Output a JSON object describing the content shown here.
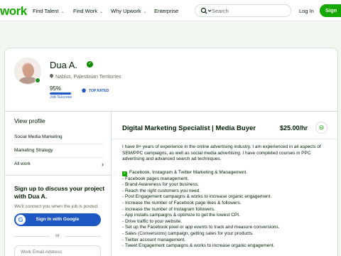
{
  "nav": {
    "logo": "work",
    "items": [
      {
        "label": "Find Talent"
      },
      {
        "label": "Find Work"
      },
      {
        "label": "Why Upwork"
      },
      {
        "label": "Enterprise"
      }
    ],
    "search_placeholder": "Search",
    "login_label": "Log In",
    "signup_label": "Sign"
  },
  "profile": {
    "name": "Dua A.",
    "location": "Nablus, Palestinian Territories",
    "job_success": "95%",
    "job_success_fraction": 0.95,
    "job_success_label": "Job Success",
    "badge": "TOP RATED"
  },
  "sidebar": {
    "view_profile": "View profile",
    "items": [
      {
        "label": "Social Media Marketing"
      },
      {
        "label": "Marketing Strategy"
      },
      {
        "label": "All work"
      }
    ],
    "signup_title": "Sign up to discuss your project with Dua A.",
    "signup_sub": "We'll connect you when the job is posted.",
    "google_label": "Sign In with Google",
    "google_glyph": "G",
    "or": "or",
    "email_placeholder": "Work Email Address"
  },
  "main": {
    "title": "Digital Marketing Specialist | Media Buyer",
    "rate": "$25.00/hr",
    "overview": "I have 8+ years of experience in the online advertising industry. I am experienced in all aspects of SEM/PPC campaigns, as well as social media advertising. I have completed courses in PPC advertising and advanced search ad techniques.",
    "bullets": [
      "Facebook, Instagram & Twitter Marketing & Management.",
      "- Facebook pages management.",
      "- Brand Awareness for your business.",
      "- Reach the right customers you need.",
      "- Post Engagement campaigns & works to increase organic engagement.",
      "- Increase the number of Facebook page likes & followers.",
      "- Increase the number of Instagram followers.",
      "- App installs campaigns & optimize to get the lowest CPI.",
      "- Drive traffic to your website.",
      "- Set up the Facebook pixel or app events to track and measure conversions.",
      "- Sales (Conversions) campaign, getting sales for your products.",
      "- Twitter account management.",
      "- Tweet Engagement campaigns & works to increase organic engagement."
    ]
  },
  "colors": {
    "brand": "#14a800",
    "accent_blue": "#1f57c3",
    "text": "#001e00",
    "muted": "#5e6d55"
  },
  "icons": [
    "search-icon",
    "chevron-down-icon",
    "verified-icon",
    "location-pin-icon",
    "top-rated-icon",
    "chevron-right-icon",
    "google-icon",
    "link-icon",
    "check-icon"
  ]
}
